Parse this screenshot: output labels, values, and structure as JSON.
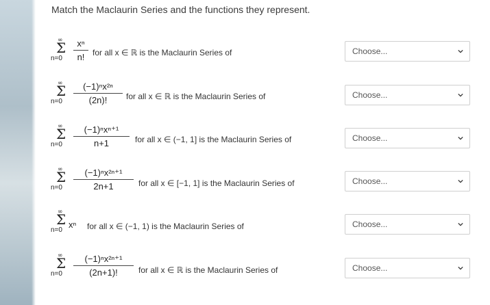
{
  "title": "Match the Maclaurin Series and the functions they represent.",
  "select_placeholder": "Choose...",
  "items": [
    {
      "sum_top": "∞",
      "sum_bottom": "n=0",
      "numerator": "xⁿ",
      "denominator": "n!",
      "description": "for all x ∈ ℝ is the Maclaurin Series of",
      "selected": "Choose..."
    },
    {
      "sum_top": "∞",
      "sum_bottom": "n=0",
      "numerator": "(−1)ⁿx²ⁿ",
      "denominator": "(2n)!",
      "description": "for all x ∈ ℝ is the Maclaurin Series of",
      "selected": "Choose..."
    },
    {
      "sum_top": "∞",
      "sum_bottom": "n=0",
      "numerator": "(−1)ⁿxⁿ⁺¹",
      "denominator": "n+1",
      "description": "for all x ∈ (−1, 1] is the Maclaurin Series of",
      "selected": "Choose..."
    },
    {
      "sum_top": "∞",
      "sum_bottom": "n=0",
      "numerator": "(−1)ⁿx²ⁿ⁺¹",
      "denominator": "2n+1",
      "description": "for all x ∈ [−1, 1] is the Maclaurin Series of",
      "selected": "Choose..."
    },
    {
      "sum_top": "∞",
      "sum_bottom": "n=0",
      "term": "xⁿ",
      "description": "for all x ∈ (−1, 1) is the Maclaurin Series of",
      "selected": "Choose..."
    },
    {
      "sum_top": "∞",
      "sum_bottom": "n=0",
      "numerator": "(−1)ⁿx²ⁿ⁺¹",
      "denominator": "(2n+1)!",
      "description": "for all x ∈ ℝ is the Maclaurin Series of",
      "selected": "Choose..."
    }
  ],
  "icons": {
    "dropdown": "chevron-down-icon",
    "summation": "sigma-symbol"
  },
  "colors": {
    "border": "#cfcfcf",
    "text": "#333333"
  }
}
